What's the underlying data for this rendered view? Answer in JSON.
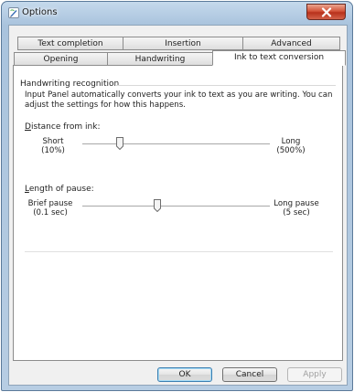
{
  "window": {
    "title": "Options",
    "close_symbol": "x-icon"
  },
  "tabs": {
    "row_back": [
      "Text completion",
      "Insertion",
      "Advanced"
    ],
    "row_front": [
      "Opening",
      "Handwriting",
      "Ink to text conversion"
    ],
    "selected": "Ink to text conversion"
  },
  "group": {
    "title": "Handwriting recognition",
    "description": "Input Panel automatically converts your ink to text as you are writing. You can adjust the settings for how this happens."
  },
  "distance": {
    "label": "Distance from ink:",
    "mnemonic": "D",
    "rest": "istance from ink:",
    "min_label": "Short",
    "min_value": "(10%)",
    "max_label": "Long",
    "max_value": "(500%)",
    "position_percent": 20
  },
  "pause": {
    "label": "Length of pause:",
    "mnemonic": "L",
    "rest": "ength of pause:",
    "min_label": "Brief pause",
    "min_value": "(0.1 sec)",
    "max_label": "Long pause",
    "max_value": "(5 sec)",
    "position_percent": 40
  },
  "buttons": {
    "ok": "OK",
    "cancel": "Cancel",
    "apply": "Apply"
  },
  "colors": {
    "titlebar": "#b7cde3",
    "close": "#c8432a",
    "panel": "#ffffff",
    "dialog_bg": "#f0f0f0"
  }
}
